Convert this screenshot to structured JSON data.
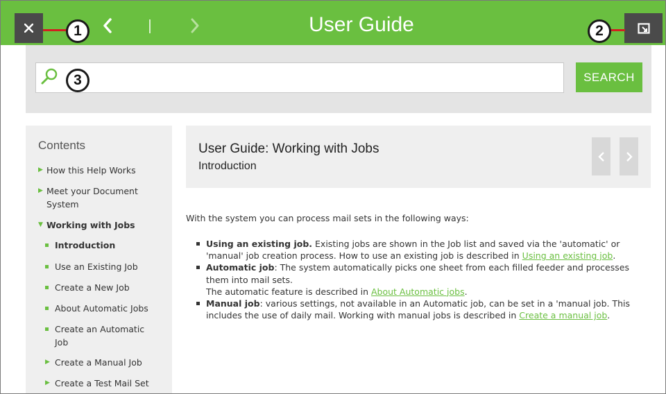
{
  "header": {
    "title": "User Guide",
    "accent": "#6abf40"
  },
  "callouts": [
    "1",
    "2",
    "3"
  ],
  "search": {
    "value": "",
    "placeholder": "",
    "button_label": "SEARCH"
  },
  "sidebar": {
    "title": "Contents",
    "items": [
      {
        "label": "How this Help Works"
      },
      {
        "label": "Meet your Document System"
      },
      {
        "label": "Working with Jobs"
      },
      {
        "label": "Introduction"
      },
      {
        "label": "Use an Existing Job"
      },
      {
        "label": "Create a New Job"
      },
      {
        "label": "About Automatic Jobs"
      },
      {
        "label": "Create an Automatic Job"
      },
      {
        "label": "Create a Manual Job"
      },
      {
        "label": "Create a Test Mail Set"
      }
    ]
  },
  "content": {
    "title": "User Guide: Working with Jobs",
    "subtitle": "Introduction",
    "intro": "With the system you can process mail sets in the following ways:",
    "bullets": [
      {
        "term": "Using an existing job.",
        "text": " Existing jobs are shown in the Job list and saved via the 'automatic' or 'manual' job creation process. How to use an existing job is described in ",
        "link": "Using an existing job",
        "tail": "."
      },
      {
        "term": "Automatic job",
        "text": ": The system automatically picks one sheet from each filled feeder and processes them into mail sets.",
        "line2": "The automatic feature is described in ",
        "link": "About Automatic jobs",
        "tail": "."
      },
      {
        "term": "Manual job",
        "text": ": various settings, not available in an Automatic job, can be set in a 'manual job. This includes the use of daily mail. Working with manual jobs is described in ",
        "link": "Create a manual job",
        "tail": "."
      }
    ]
  }
}
